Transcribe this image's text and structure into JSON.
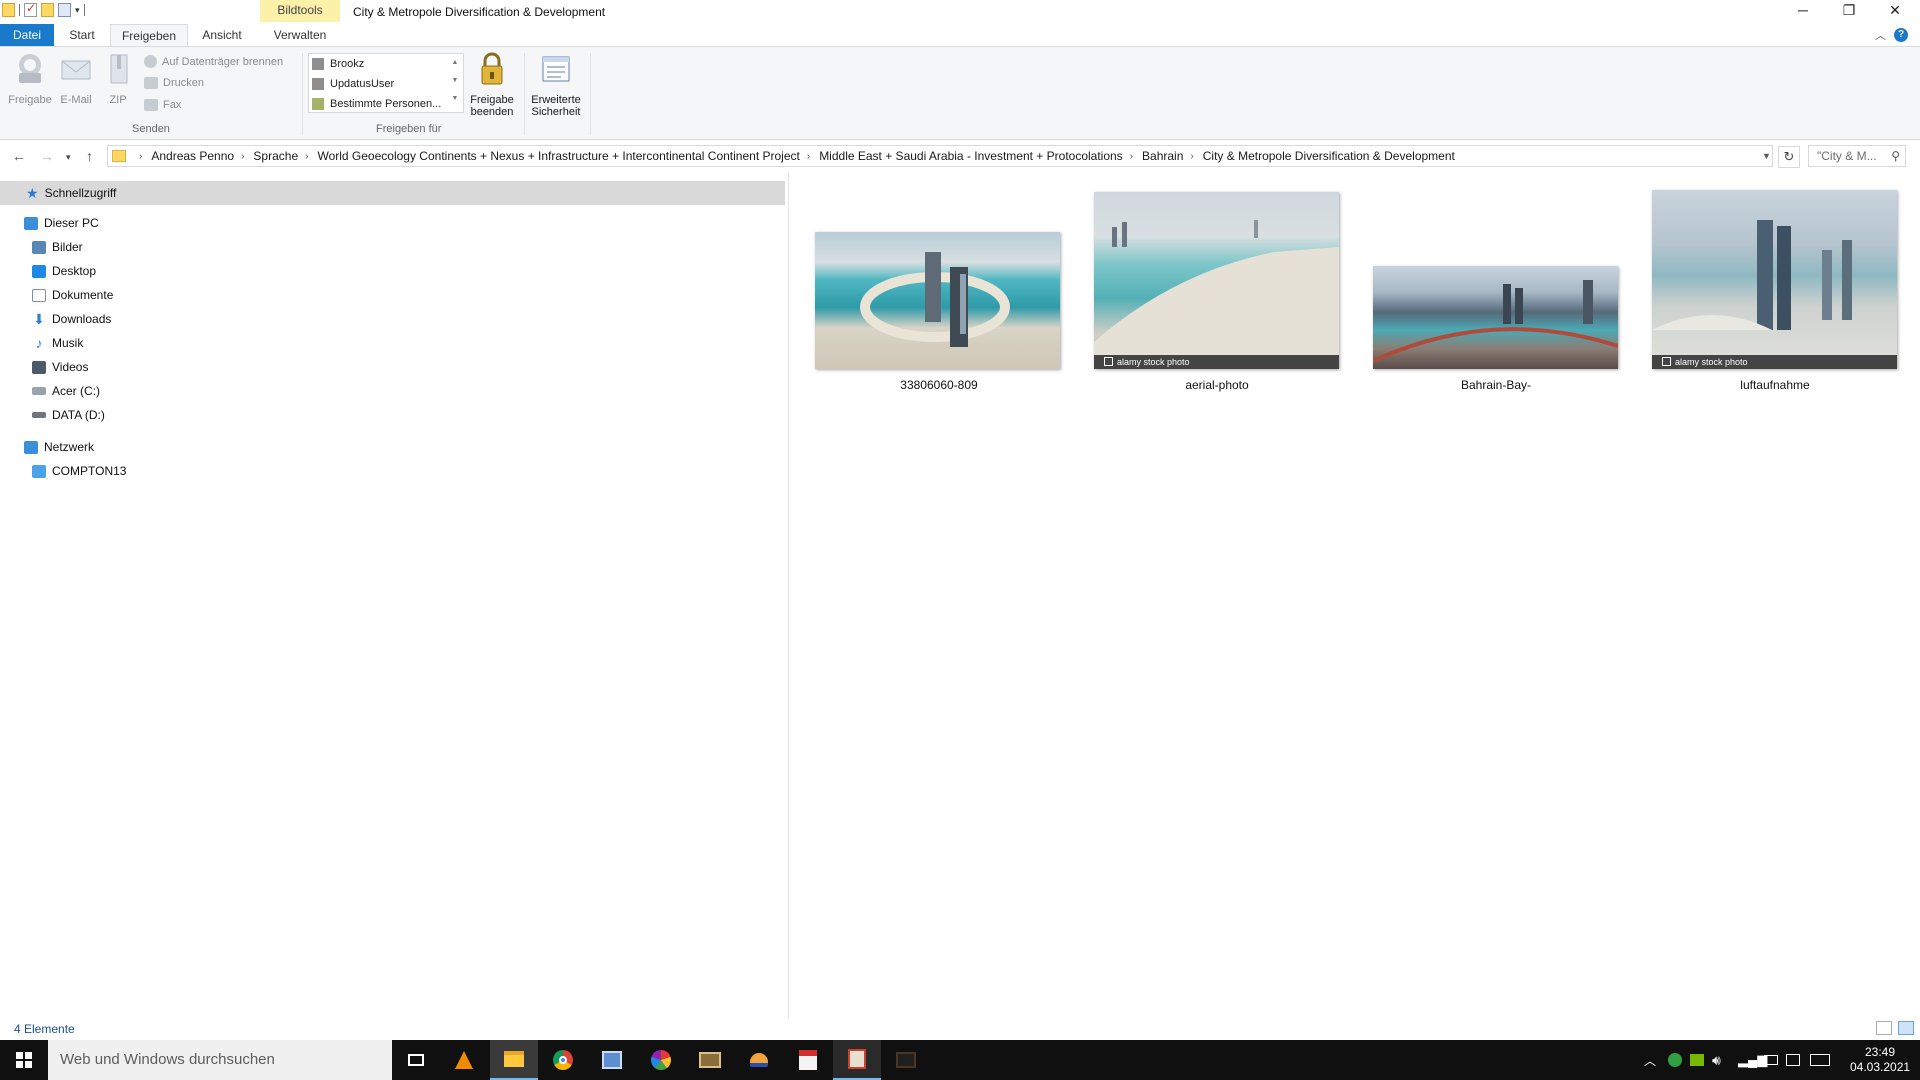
{
  "titlebar": {
    "context_tab": "Bildtools",
    "title": "City & Metropole Diversification & Development"
  },
  "tabs": {
    "file": "Datei",
    "start": "Start",
    "share": "Freigeben",
    "view": "Ansicht",
    "manage": "Verwalten"
  },
  "ribbon": {
    "share_btn": "Freigabe",
    "email_btn": "E-Mail",
    "zip_btn": "ZIP",
    "burn_btn": "Auf Datenträger brennen",
    "print_btn": "Drucken",
    "fax_btn": "Fax",
    "send_group": "Senden",
    "share_with": [
      "Brookz",
      "UpdatusUser",
      "Bestimmte Personen..."
    ],
    "share_group": "Freigeben für",
    "stop_share_line1": "Freigabe",
    "stop_share_line2": "beenden",
    "adv_sec_line1": "Erweiterte",
    "adv_sec_line2": "Sicherheit"
  },
  "address": {
    "crumbs": [
      "Andreas Penno",
      "Sprache",
      "World Geoecology Continents + Nexus + Infrastructure + Intercontinental Continent Project",
      "Middle East + Saudi Arabia - Investment + Protocolations",
      "Bahrain",
      "City & Metropole Diversification & Development"
    ],
    "search_placeholder": "\"City & M..."
  },
  "nav": {
    "quick_access": "Schnellzugriff",
    "this_pc": "Dieser PC",
    "pc_items": [
      "Bilder",
      "Desktop",
      "Dokumente",
      "Downloads",
      "Musik",
      "Videos",
      "Acer (C:)",
      "DATA (D:)"
    ],
    "network": "Netzwerk",
    "network_items": [
      "COMPTON13"
    ]
  },
  "files": [
    {
      "name": "33806060-809",
      "watermark": ""
    },
    {
      "name": "aerial-photo",
      "watermark": "alamy stock photo"
    },
    {
      "name": "Bahrain-Bay-",
      "watermark": ""
    },
    {
      "name": "luftaufnahme",
      "watermark": "alamy stock photo"
    }
  ],
  "status": {
    "count": "4 Elemente"
  },
  "taskbar": {
    "search_placeholder": "Web und Windows durchsuchen",
    "time": "23:49",
    "date": "04.03.2021"
  },
  "colors": {
    "accent": "#1979ca",
    "context_tab_bg": "#fbf1a9",
    "selection_bg": "#d9d9d9",
    "taskbar_bg": "#101010"
  }
}
